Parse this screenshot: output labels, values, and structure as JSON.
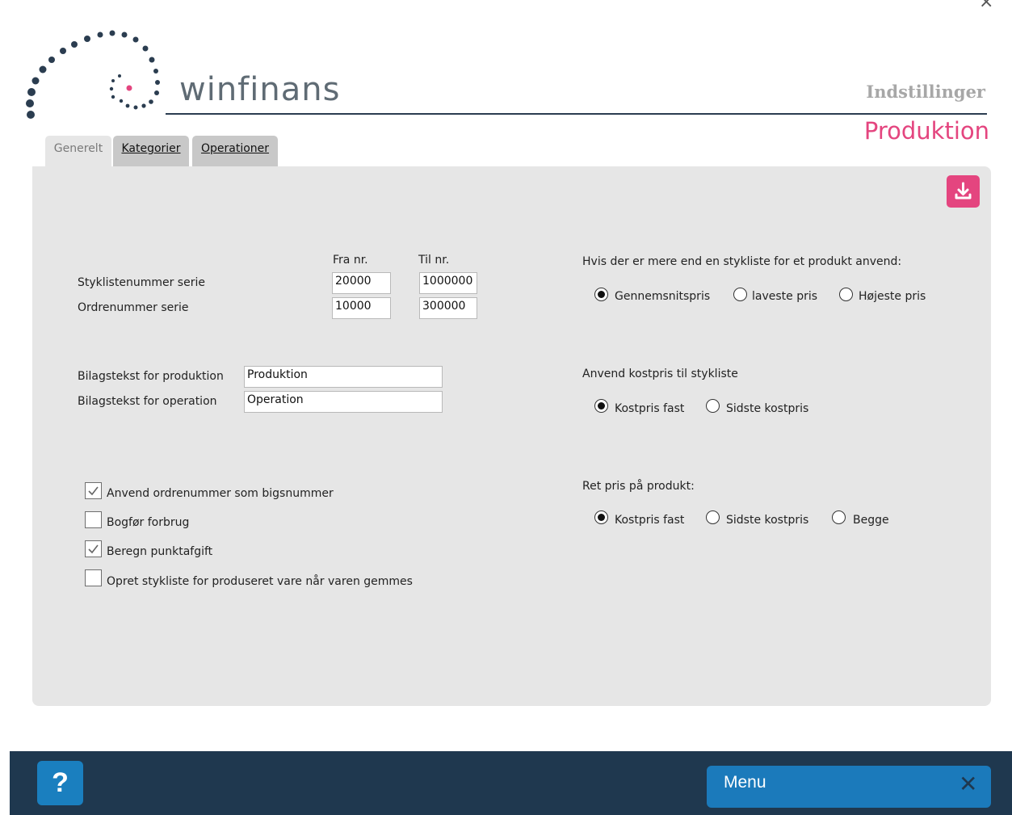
{
  "header": {
    "logo_text": "winfinans",
    "subtitle": "Indstillinger",
    "title": "Produktion",
    "close_glyph": "×"
  },
  "tabs": [
    {
      "label": "Generelt",
      "active": true
    },
    {
      "label": "Kategorier",
      "active": false
    },
    {
      "label": "Operationer",
      "active": false
    }
  ],
  "toolbar": {
    "download_icon": "download-icon"
  },
  "number_series": {
    "from_header": "Fra nr.",
    "to_header": "Til nr.",
    "rows": [
      {
        "label": "Styklistenummer serie",
        "from": "20000",
        "to": "1000000"
      },
      {
        "label": "Ordrenummer serie",
        "from": "10000",
        "to": "300000"
      }
    ]
  },
  "texts": {
    "production": {
      "label": "Bilagstekst for produktion",
      "value": "Produktion"
    },
    "operation": {
      "label": "Bilagstekst for operation",
      "value": "Operation"
    }
  },
  "options": [
    {
      "label": "Anvend ordrenummer som bigsnummer",
      "checked": true
    },
    {
      "label": "Bogfør forbrug",
      "checked": false
    },
    {
      "label": "Beregn punktafgift",
      "checked": true
    },
    {
      "label": "Opret stykliste for produseret vare når varen gemmes",
      "checked": false
    }
  ],
  "multi_bom": {
    "question": "Hvis der er mere end en stykliste for et produkt anvend:",
    "choices": [
      "Gennemsnitspris",
      "laveste pris",
      "Højeste pris"
    ],
    "selected": 0
  },
  "cost_price": {
    "question": "Anvend kostpris til stykliste",
    "choices": [
      "Kostpris fast",
      "Sidste kostpris"
    ],
    "selected": 0
  },
  "price_fix": {
    "question": "Ret pris på produkt:",
    "choices": [
      "Kostpris fast",
      "Sidste kostpris",
      "Begge"
    ],
    "selected": 0
  },
  "footer": {
    "help_label": "?",
    "menu_label": "Menu",
    "menu_close": "✕"
  },
  "colors": {
    "accent": "#e4457f",
    "navy": "#1f384f",
    "blue": "#1b7abb",
    "panel": "#e6e6e6"
  }
}
